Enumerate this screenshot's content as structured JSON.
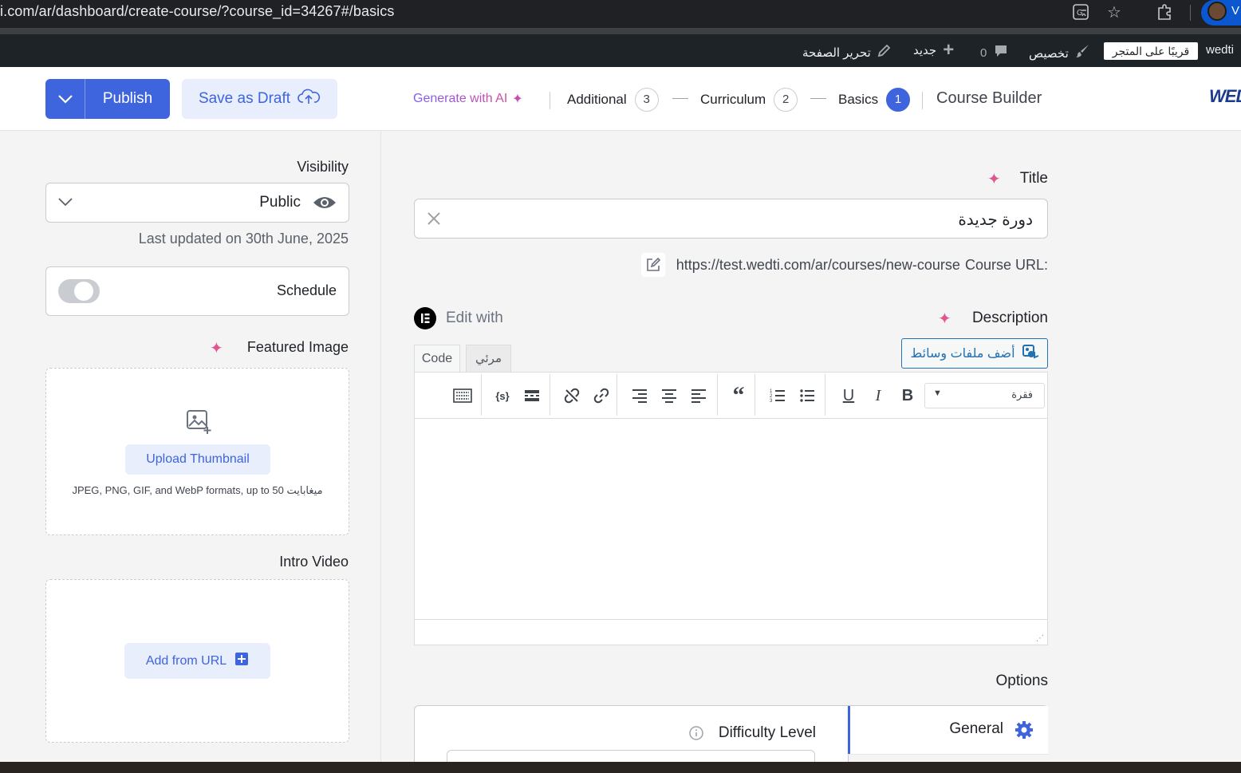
{
  "browser": {
    "url": "i.com/ar/dashboard/create-course/?course_id=34267#/basics",
    "profile_letter": "V"
  },
  "adminbar": {
    "site_name": "wedti",
    "coming_soon": "قريبًا على المتجر",
    "customize": "تخصيص",
    "comments_count": "0",
    "new": "جديد",
    "edit_page": "تحرير الصفحة"
  },
  "header": {
    "publish_label": "Publish",
    "save_draft_label": "Save as Draft",
    "generate_ai_label": "Generate with AI",
    "steps": [
      {
        "label": "Additional",
        "num": "3"
      },
      {
        "label": "Curriculum",
        "num": "2"
      },
      {
        "label": "Basics",
        "num": "1"
      }
    ],
    "builder_title": "Course Builder",
    "logo_text": "WED"
  },
  "sidebar": {
    "visibility_label": "Visibility",
    "visibility_value": "Public",
    "last_updated": "Last updated on 30th June, 2025",
    "schedule_label": "Schedule",
    "schedule_enabled": false,
    "featured_image_label": "Featured Image",
    "upload_thumbnail_label": "Upload Thumbnail",
    "upload_hint": "JPEG, PNG, GIF, and WebP formats, up to 50 ميغابايت",
    "intro_video_label": "Intro Video",
    "add_from_url_label": "Add from URL"
  },
  "main": {
    "title_label": "Title",
    "title_value": "دورة جديدة",
    "course_url_label": "Course URL:",
    "course_url": "https://test.wedti.com/ar/courses/new-course",
    "description_label": "Description",
    "edit_with_label": "Edit with",
    "add_media_label": "أضف ملفات وسائط",
    "tab_visual": "مرئي",
    "tab_code": "Code",
    "format_select": "فقرة",
    "options_label": "Options",
    "options_tab_general": "General",
    "difficulty_label": "Difficulty Level"
  },
  "colors": {
    "primary": "#3e64de",
    "primary_soft": "#e9eefc",
    "ai_gradient_start": "#7c5cf5",
    "ai_gradient_end": "#e44a8c",
    "adminbar_bg": "#1d2327"
  }
}
